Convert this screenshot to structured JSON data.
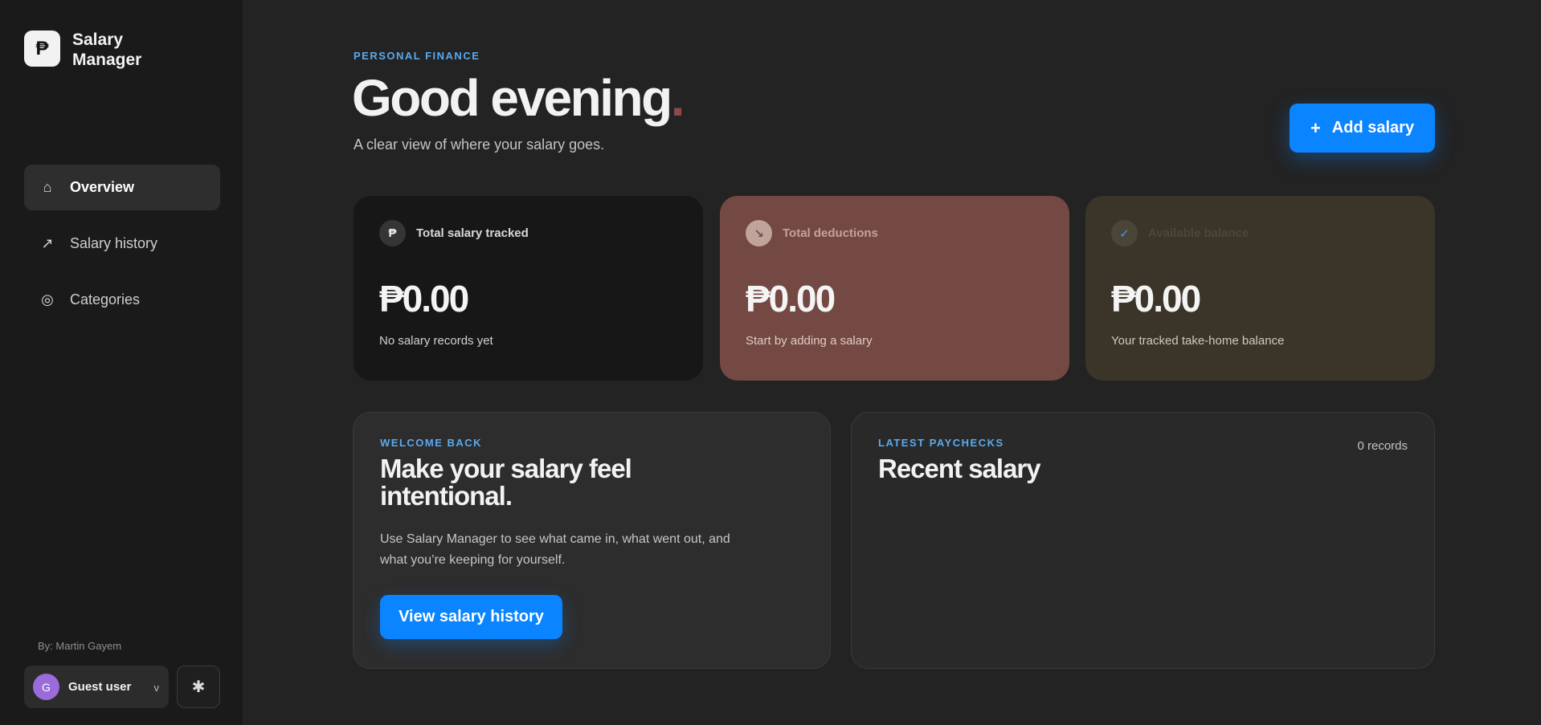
{
  "app": {
    "logo_glyph": "₱",
    "name": "Salary Manager"
  },
  "nav": {
    "items": [
      {
        "icon": "home-icon",
        "glyph": "⌂",
        "label": "Overview",
        "active": true
      },
      {
        "icon": "trend-arrow-icon",
        "glyph": "↗",
        "label": "Salary history",
        "active": false
      },
      {
        "icon": "target-icon",
        "glyph": "◎",
        "label": "Categories",
        "active": false
      }
    ]
  },
  "footer": {
    "byline": "By: Martin Gayem",
    "user_initial": "G",
    "user_name": "Guest user",
    "user_chevron": "v",
    "theme_glyph": "✱"
  },
  "header": {
    "eyebrow": "PERSONAL FINANCE",
    "title": "Good evening",
    "title_dot": ".",
    "subtitle": "A clear view of where your salary goes.",
    "add_button": {
      "glyph": "+",
      "label": "Add salary"
    }
  },
  "stats": [
    {
      "icon": "peso-icon",
      "glyph": "₱",
      "label": "Total salary tracked",
      "value": "₱0.00",
      "note": "No salary records yet"
    },
    {
      "icon": "deduction-icon",
      "glyph": "↘",
      "label": "Total deductions",
      "value": "₱0.00",
      "note": "Start by adding a salary"
    },
    {
      "icon": "check-icon",
      "glyph": "✓",
      "label": "Available balance",
      "value": "₱0.00",
      "note": "Your tracked take-home balance"
    }
  ],
  "welcome": {
    "eyebrow": "WELCOME BACK",
    "title": "Make your salary feel intentional.",
    "text": "Use Salary Manager to see what came in, what went out, and what you’re keeping for yourself.",
    "cta": "View salary history"
  },
  "recent": {
    "eyebrow": "LATEST PAYCHECKS",
    "title": "Recent salary",
    "count": "0 records"
  },
  "colors": {
    "accent": "#0a84ff",
    "eyebrow": "#5aaaf0",
    "deductions_card": "#744843",
    "balance_card": "#3b3529"
  }
}
